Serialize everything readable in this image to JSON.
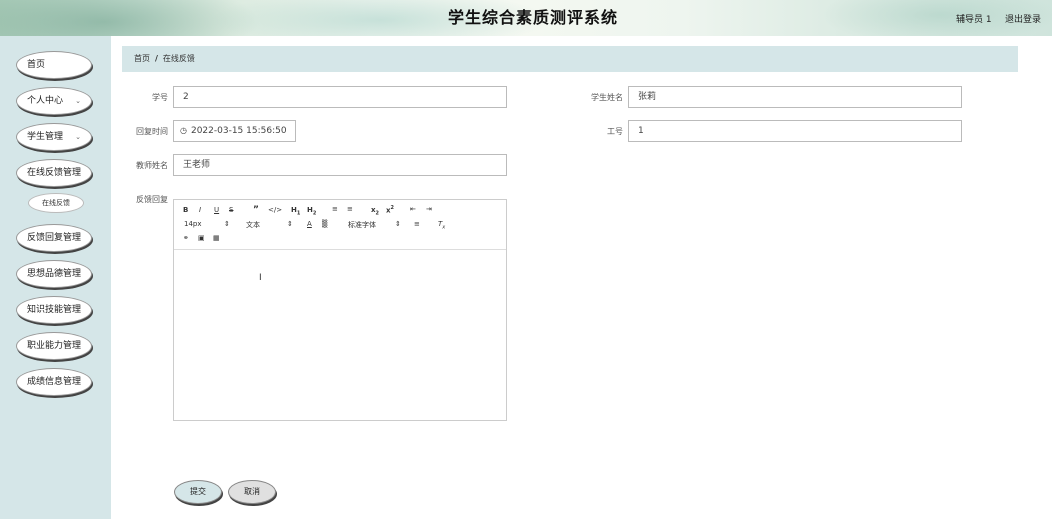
{
  "header": {
    "title": "学生综合素质测评系统",
    "user": "辅导员 1",
    "logout": "退出登录"
  },
  "sidebar": {
    "items": [
      {
        "label": "首页",
        "chevron": false
      },
      {
        "label": "个人中心",
        "chevron": true
      },
      {
        "label": "学生管理",
        "chevron": true
      },
      {
        "label": "在线反馈管理",
        "chevron": false
      },
      {
        "label": "反馈回复管理",
        "chevron": false
      },
      {
        "label": "思想品德管理",
        "chevron": false
      },
      {
        "label": "知识技能管理",
        "chevron": false
      },
      {
        "label": "职业能力管理",
        "chevron": false
      },
      {
        "label": "成绩信息管理",
        "chevron": false
      }
    ],
    "sub_item": "在线反馈"
  },
  "breadcrumb": {
    "home": "首页",
    "separator": "/",
    "current": "在线反馈"
  },
  "form": {
    "student_id_label": "学号",
    "student_id_value": "2",
    "student_name_label": "学生姓名",
    "student_name_value": "张莉",
    "reply_time_label": "回复时间",
    "reply_time_value": "2022-03-15 15:56:50",
    "job_no_label": "工号",
    "job_no_value": "1",
    "teacher_name_label": "教师姓名",
    "teacher_name_value": "王老师",
    "feedback_reply_label": "反馈回复"
  },
  "editor": {
    "font_size": "14px",
    "heading": "文本",
    "font_family": "标准字体"
  },
  "buttons": {
    "submit": "提交",
    "cancel": "取消"
  },
  "colors": {
    "sidebar_bg": "#d5e6e8",
    "breadcrumb_bg": "#d5e6e8",
    "submit_bg": "#d5e6e8",
    "cancel_bg": "#e0e0e0"
  }
}
